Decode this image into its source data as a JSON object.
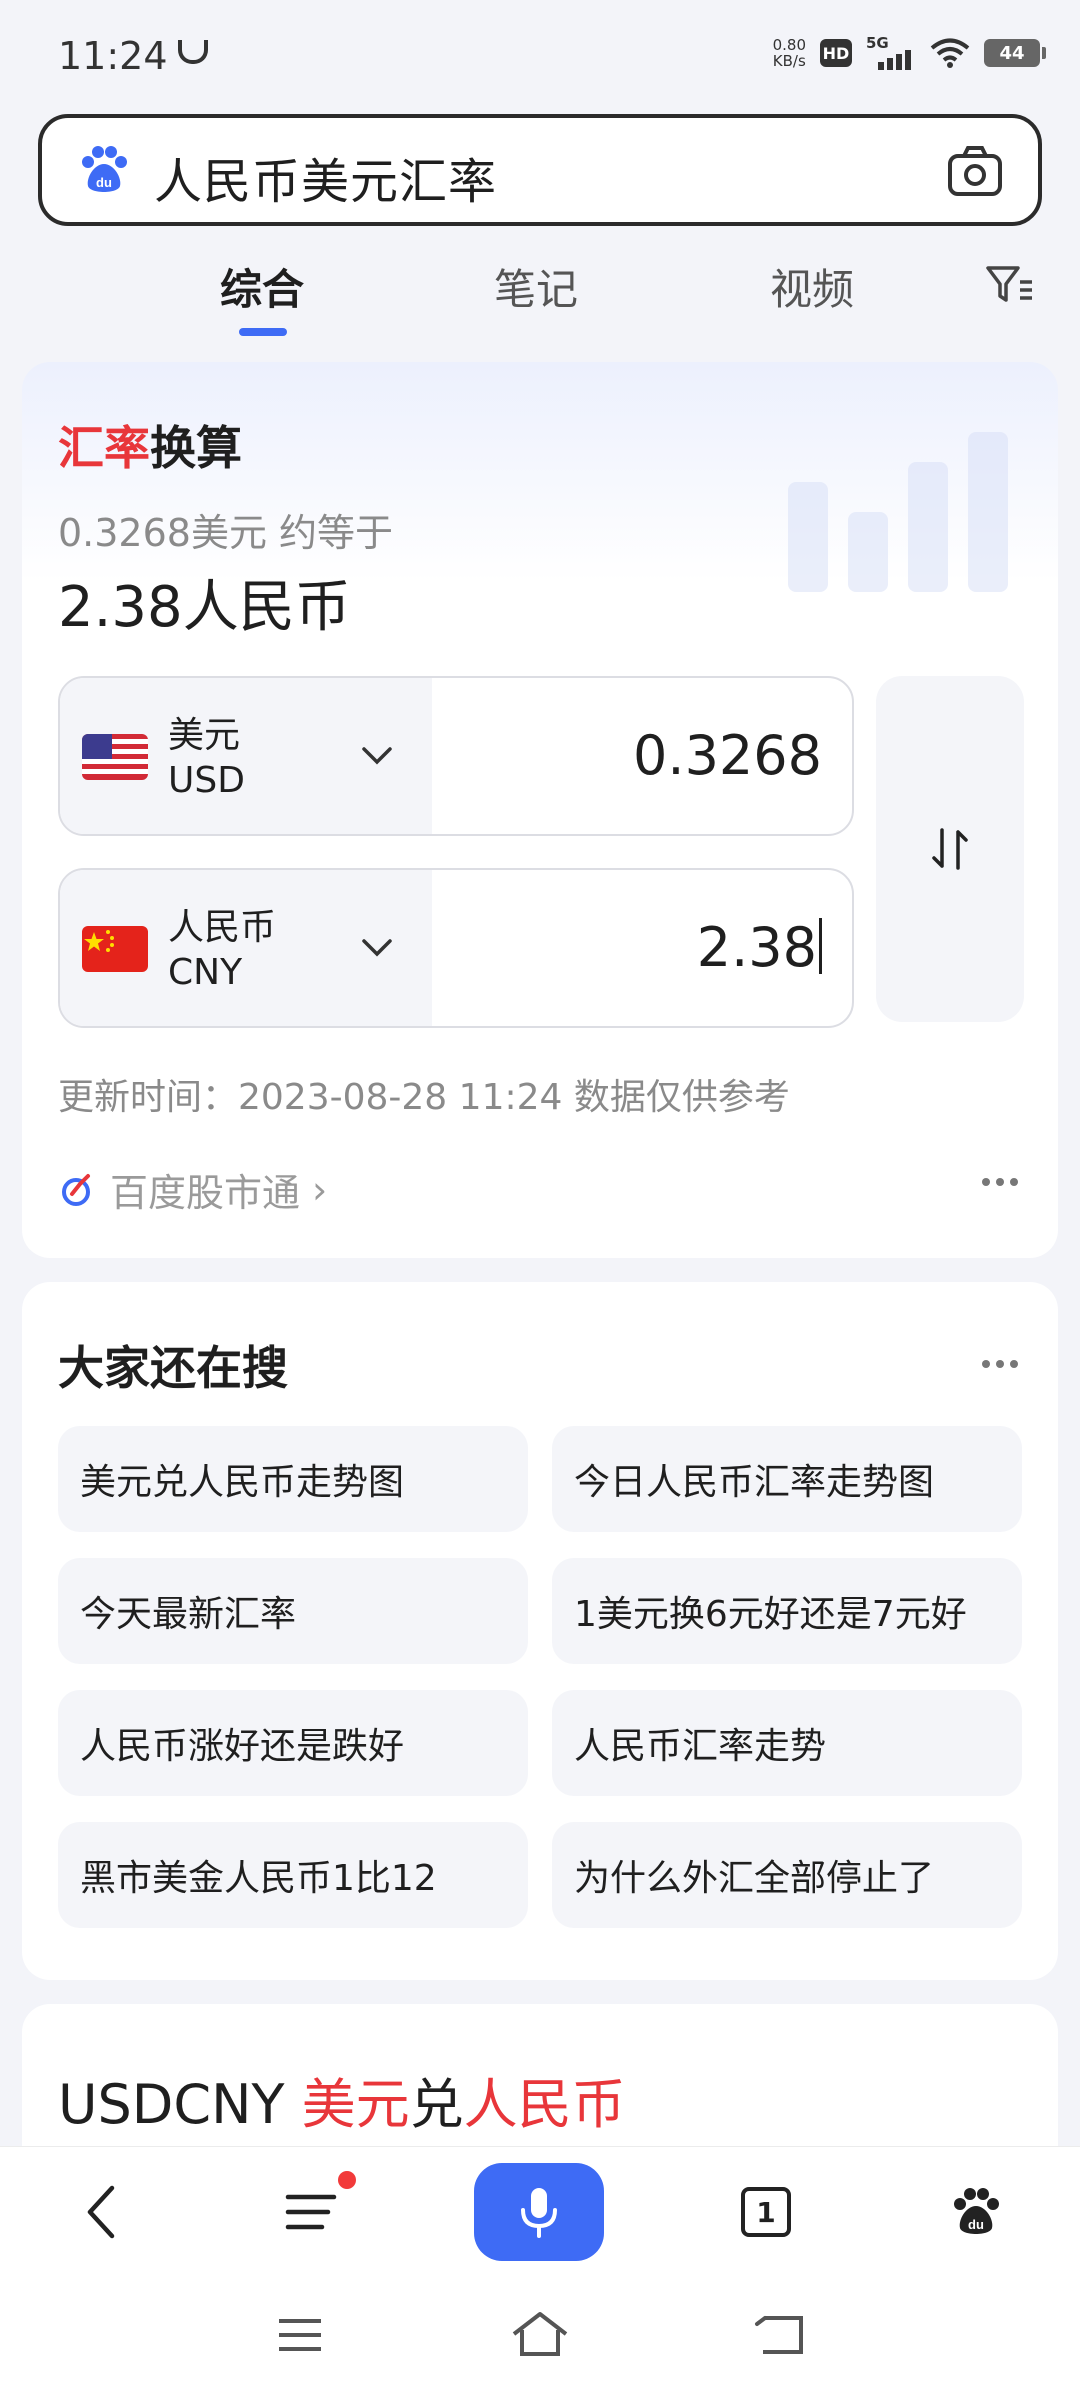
{
  "status_bar": {
    "time": "11:24",
    "net_speed_value": "0.80",
    "net_speed_unit": "KB/s",
    "hd": "HD",
    "network": "5G",
    "battery": "44"
  },
  "search": {
    "query": "人民币美元汇率",
    "logo_icon": "baidu-paw-icon",
    "camera_icon": "camera-icon"
  },
  "tabs": [
    {
      "label": "综合",
      "active": true
    },
    {
      "label": "笔记",
      "active": false
    },
    {
      "label": "视频",
      "active": false
    }
  ],
  "exchange": {
    "title_red": "汇率",
    "title_black": "换算",
    "subtitle": "0.3268美元 约等于",
    "result": "2.38人民币",
    "from": {
      "name": "美元",
      "code": "USD",
      "value": "0.3268"
    },
    "to": {
      "name": "人民币",
      "code": "CNY",
      "value": "2.38"
    },
    "update_text": "更新时间：2023-08-28 11:24 数据仅供参考",
    "source": "百度股市通",
    "source_arrow": "›"
  },
  "related": {
    "title": "大家还在搜",
    "items": [
      "美元兑人民币走势图",
      "今日人民币汇率走势图",
      "今天最新汇率",
      "1美元换6元好还是7元好",
      "人民币涨好还是跌好",
      "人民币汇率走势",
      "黑市美金人民币1比12",
      "为什么外汇全部停止了"
    ]
  },
  "usdcny": {
    "code": "USDCNY",
    "name_red1": "美元",
    "middle": "兑",
    "name_red2": "人民币"
  },
  "toolbar": {
    "tabs_count": "1"
  },
  "colors": {
    "accent": "#3e6bf5",
    "highlight_red": "#e8363a",
    "background": "#f3f4f9"
  }
}
